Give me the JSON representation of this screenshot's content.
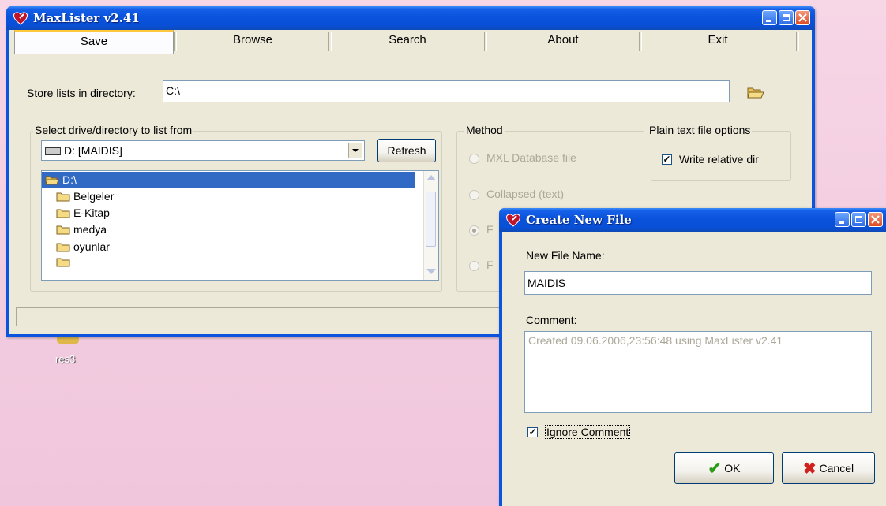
{
  "main": {
    "title": "MaxLister v2.41",
    "tabs": [
      "Save",
      "Browse",
      "Search",
      "About",
      "Exit"
    ],
    "store_label": "Store lists in directory:",
    "store_value": "C:\\",
    "select_group_label": "Select drive/directory to list from",
    "drive_value": "D: [MAIDIS]",
    "refresh_label": "Refresh",
    "tree": {
      "root": "D:\\",
      "items": [
        "Belgeler",
        "E-Kitap",
        "medya",
        "oyunlar"
      ]
    },
    "method_label": "Method",
    "method_options": [
      "MXL Database file",
      "Collapsed (text)",
      "F",
      "F"
    ],
    "plain_label": "Plain text file options",
    "write_relative_label": "Write relative dir"
  },
  "desktop_icon_label": "res3",
  "dialog": {
    "title": "Create New File",
    "name_label": "New File Name:",
    "name_value": "MAIDIS",
    "comment_label": "Comment:",
    "comment_value": "Created 09.06.2006,23:56:48 using MaxLister v2.41",
    "ignore_label": "Ignore Comment",
    "ok_label": "OK",
    "cancel_label": "Cancel"
  },
  "colors": {
    "xp_blue": "#0b54de",
    "face": "#ece9d8",
    "selection": "#316ac5"
  }
}
